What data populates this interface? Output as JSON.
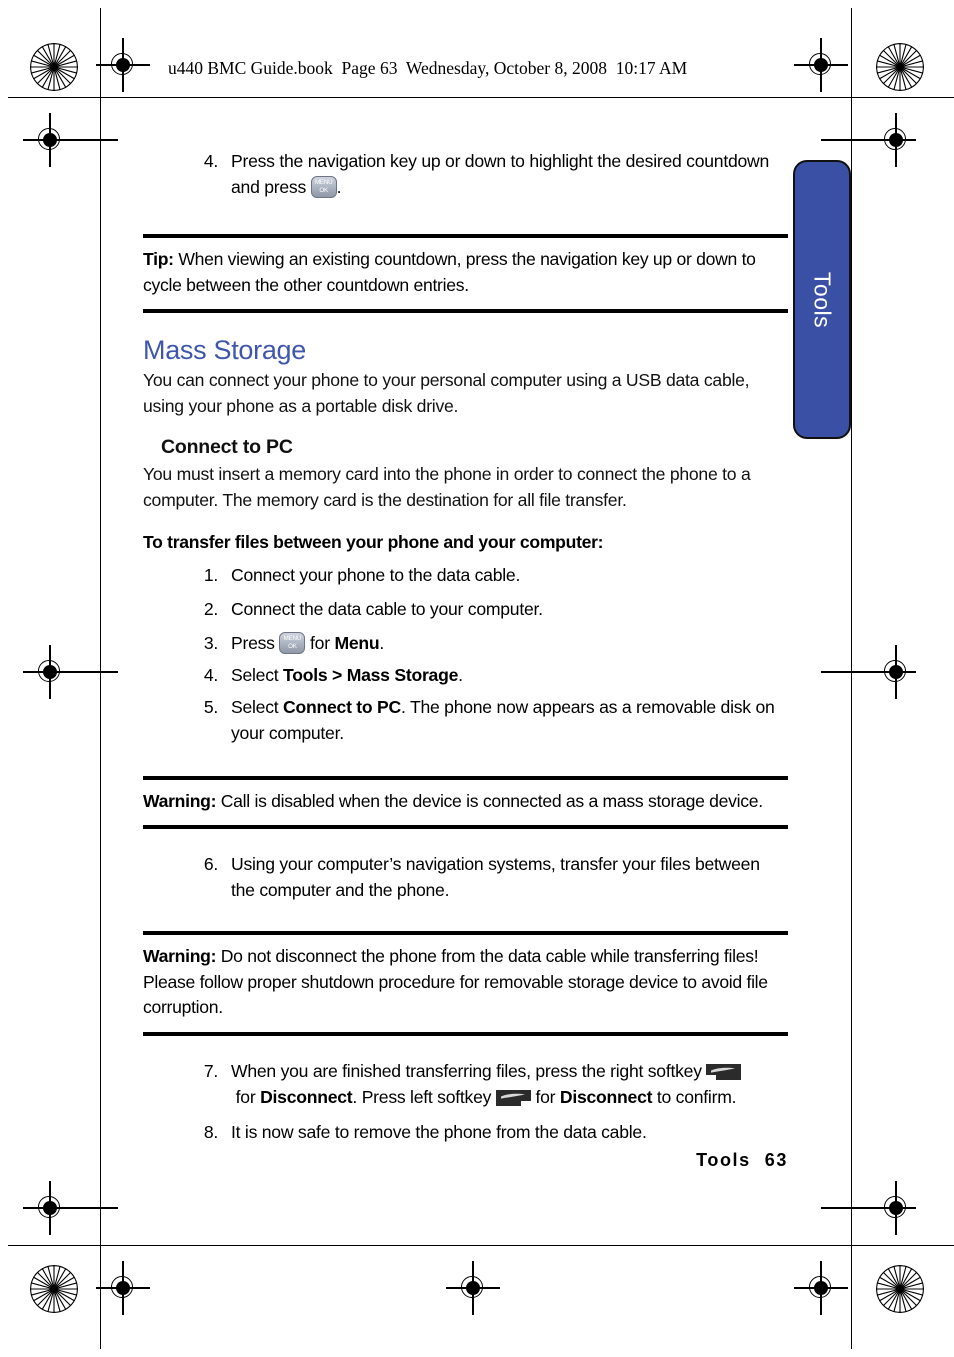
{
  "page": {
    "header_line": "u440 BMC Guide.book  Page 63  Wednesday, October 8, 2008  10:17 AM",
    "side_tab_label": "Tools",
    "footer_section": "Tools",
    "footer_page": "63",
    "accent_color": "#3a50a4",
    "heading_color": "#3e56ac"
  },
  "step4_prev": {
    "num": "4.",
    "text_before": "Press the navigation key up or down to highlight the desired countdown and press",
    "text_after": ".",
    "key_icon": "menu-ok-key-icon",
    "key_line1": "MENU",
    "key_line2": "OK"
  },
  "tip": {
    "label": "Tip:",
    "text": " When viewing an existing countdown, press the navigation key up or down to cycle between the other countdown entries."
  },
  "mass_storage": {
    "title": "Mass Storage",
    "intro": "You can connect your phone to your personal computer using a USB data cable, using your phone as a portable disk drive.",
    "sub_title": "Connect to PC",
    "sub_intro": "You must insert a memory card into the phone in order to connect the phone to a computer. The memory card is the destination for all file transfer.",
    "procedure_lead": "To transfer files between your phone and your computer:"
  },
  "steps": {
    "s1": {
      "num": "1.",
      "text": "Connect your phone to the data cable."
    },
    "s2": {
      "num": "2.",
      "text": "Connect the data cable to your computer."
    },
    "s3": {
      "num": "3.",
      "a": "Press",
      "b": "for",
      "c": "Menu",
      "d": "."
    },
    "s4": {
      "num": "4.",
      "a": "Select",
      "b": "Tools > Mass Storage",
      "c": "."
    },
    "s5": {
      "num": "5.",
      "a": "Select",
      "b": "Connect to PC",
      "c": ". The phone now appears as a removable disk on your computer."
    },
    "s6": {
      "num": "6.",
      "text": "Using your computer’s navigation systems, transfer your files between the computer and the phone."
    },
    "s7": {
      "num": "7.",
      "a": "When you are finished transferring files, press the right softkey",
      "b": "for",
      "c": "Disconnect",
      "d": ". Press left softkey",
      "e": "for",
      "f": "Disconnect",
      "g": "to confirm.",
      "right_softkey_icon": "right-softkey-icon",
      "left_softkey_icon": "left-softkey-icon"
    },
    "s8": {
      "num": "8.",
      "text": "It is now safe to remove the phone from the data cable."
    }
  },
  "warning1": {
    "label": "Warning:",
    "text": " Call is disabled when the device is connected as a mass storage device."
  },
  "warning2": {
    "label": "Warning:",
    "text": " Do not disconnect the phone from the data cable while transferring files! Please follow proper shutdown procedure for removable storage device to avoid file corruption."
  }
}
